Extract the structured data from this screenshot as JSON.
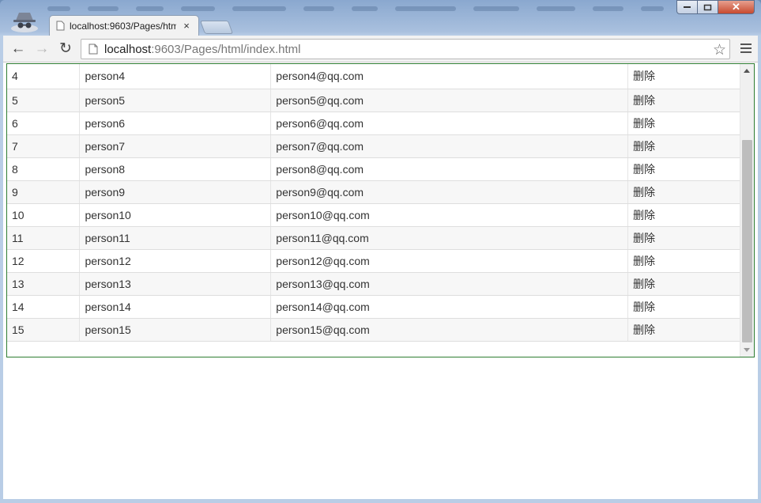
{
  "browser": {
    "tab_title": "localhost:9603/Pages/htm",
    "tab_close": "×",
    "url_host": "localhost",
    "url_rest": ":9603/Pages/html/index.html",
    "back_icon": "←",
    "forward_icon": "→",
    "reload_icon": "↻",
    "star_icon": "☆",
    "window_close": "✕"
  },
  "table": {
    "rows": [
      {
        "id": "4",
        "name": "person4",
        "email": "person4@qq.com",
        "action": "删除"
      },
      {
        "id": "5",
        "name": "person5",
        "email": "person5@qq.com",
        "action": "删除"
      },
      {
        "id": "6",
        "name": "person6",
        "email": "person6@qq.com",
        "action": "删除"
      },
      {
        "id": "7",
        "name": "person7",
        "email": "person7@qq.com",
        "action": "删除"
      },
      {
        "id": "8",
        "name": "person8",
        "email": "person8@qq.com",
        "action": "删除"
      },
      {
        "id": "9",
        "name": "person9",
        "email": "person9@qq.com",
        "action": "删除"
      },
      {
        "id": "10",
        "name": "person10",
        "email": "person10@qq.com",
        "action": "删除"
      },
      {
        "id": "11",
        "name": "person11",
        "email": "person11@qq.com",
        "action": "删除"
      },
      {
        "id": "12",
        "name": "person12",
        "email": "person12@qq.com",
        "action": "删除"
      },
      {
        "id": "13",
        "name": "person13",
        "email": "person13@qq.com",
        "action": "删除"
      },
      {
        "id": "14",
        "name": "person14",
        "email": "person14@qq.com",
        "action": "删除"
      },
      {
        "id": "15",
        "name": "person15",
        "email": "person15@qq.com",
        "action": "删除"
      }
    ]
  },
  "colors": {
    "panel_border": "#2e7d32",
    "row_alt": "#f7f7f7"
  }
}
